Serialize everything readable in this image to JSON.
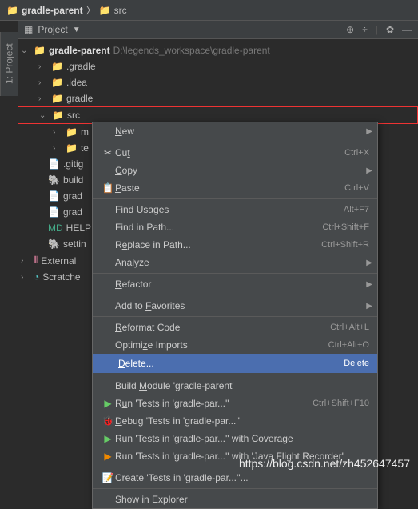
{
  "breadcrumb": {
    "root": "gradle-parent",
    "child": "src"
  },
  "side_tab": "1: Project",
  "toolbar": {
    "label": "Project"
  },
  "tree": {
    "root": {
      "name": "gradle-parent",
      "path": "D:\\legends_workspace\\gradle-parent"
    },
    "items": [
      {
        "name": ".gradle"
      },
      {
        "name": ".idea"
      },
      {
        "name": "gradle"
      },
      {
        "name": "src"
      },
      {
        "name": "m"
      },
      {
        "name": "te"
      },
      {
        "name": ".gitig"
      },
      {
        "name": "build"
      },
      {
        "name": "grad"
      },
      {
        "name": "grad"
      },
      {
        "name": "HELP"
      },
      {
        "name": "settin"
      }
    ],
    "external": "External",
    "scratches": "Scratche"
  },
  "menu": {
    "new": "New",
    "cut": {
      "label": "Cut",
      "shortcut": "Ctrl+X",
      "key": "t"
    },
    "copy": {
      "label": "Copy",
      "key": "C"
    },
    "paste": {
      "label": "Paste",
      "shortcut": "Ctrl+V",
      "key": "P"
    },
    "find_usages": {
      "label": "Find Usages",
      "shortcut": "Alt+F7",
      "key": "U"
    },
    "find_in_path": {
      "label": "Find in Path...",
      "shortcut": "Ctrl+Shift+F"
    },
    "replace_in_path": {
      "label": "Replace in Path...",
      "shortcut": "Ctrl+Shift+R",
      "key": "e"
    },
    "analyze": {
      "label": "Analyze",
      "key": "z"
    },
    "refactor": {
      "label": "Refactor",
      "key": "R"
    },
    "favorites": {
      "label": "Add to Favorites",
      "key": "F"
    },
    "reformat": {
      "label": "Reformat Code",
      "shortcut": "Ctrl+Alt+L",
      "key": "R"
    },
    "optimize": {
      "label": "Optimize Imports",
      "shortcut": "Ctrl+Alt+O",
      "key": "z"
    },
    "delete": {
      "label": "Delete...",
      "shortcut": "Delete",
      "key": "D"
    },
    "build": {
      "label": "Build Module 'gradle-parent'",
      "key": "M"
    },
    "run": {
      "label": "Run 'Tests in 'gradle-par...''",
      "shortcut": "Ctrl+Shift+F10",
      "key": "u"
    },
    "debug": {
      "label": "Debug 'Tests in 'gradle-par...''",
      "key": "D"
    },
    "coverage": {
      "label": "Run 'Tests in 'gradle-par...'' with Coverage",
      "key": "C"
    },
    "jfr": {
      "label": "Run 'Tests in 'gradle-par...'' with 'Java Flight Recorder'"
    },
    "create": {
      "label": "Create 'Tests in 'gradle-par...''..."
    },
    "explorer": "Show in Explorer"
  },
  "watermark": "https://blog.csdn.net/zh452647457"
}
